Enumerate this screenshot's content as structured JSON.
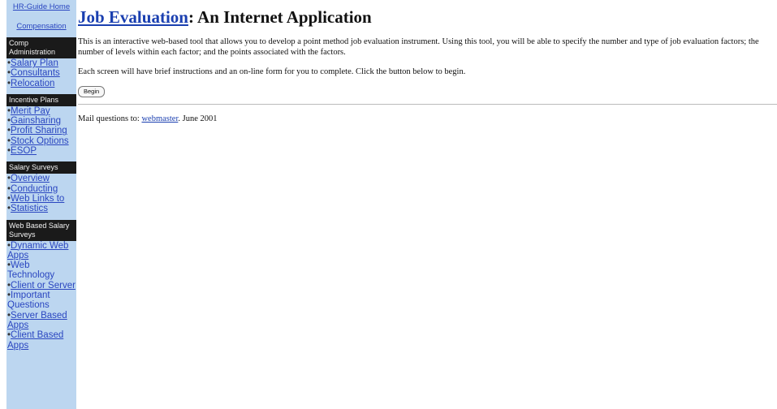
{
  "sidebar": {
    "top_links": [
      "HR-Guide Home",
      "Compensation"
    ],
    "sections": [
      {
        "header": "Comp Administration",
        "items": [
          {
            "label": "Salary Plan",
            "link": true
          },
          {
            "label": "Consultants",
            "link": true
          },
          {
            "label": "Relocation",
            "link": true
          }
        ]
      },
      {
        "header": "Incentive Plans",
        "items": [
          {
            "label": "Merit Pay",
            "link": true
          },
          {
            "label": "Gainsharing",
            "link": true
          },
          {
            "label": "Profit Sharing",
            "link": true
          },
          {
            "label": "Stock Options",
            "link": true
          },
          {
            "label": "ESOP",
            "link": true
          }
        ]
      },
      {
        "header": "Salary Surveys",
        "items": [
          {
            "label": "Overview",
            "link": true
          },
          {
            "label": "Conducting",
            "link": true
          },
          {
            "label": "Web Links to",
            "link": true
          },
          {
            "label": "Statistics",
            "link": true
          }
        ]
      },
      {
        "header": "Web Based Salary Surveys",
        "items": [
          {
            "label": "Dynamic Web Apps",
            "link": true
          },
          {
            "label": "Web Technology",
            "link": false
          },
          {
            "label": "Client or Server",
            "link": true
          },
          {
            "label": "Important Questions",
            "link": false
          },
          {
            "label": "Server Based Apps",
            "link": true
          },
          {
            "label": "Client Based Apps",
            "link": true
          }
        ]
      }
    ]
  },
  "main": {
    "title_link": "Job Evaluation",
    "title_rest": ": An Internet Application",
    "intro": "This is an interactive web-based tool that allows you to develop a point method job evaluation instrument. Using this tool, you will be able to specify the number and type of job evaluation factors; the number of levels within each factor; and the points associated with the factors.",
    "instructions": "Each screen will have brief instructions and an on-line form for you to complete. Click the button below to begin.",
    "begin_button": "Begin",
    "footer": {
      "prefix": "Mail questions to: ",
      "link": "webmaster",
      "suffix": ". June 2001"
    }
  }
}
